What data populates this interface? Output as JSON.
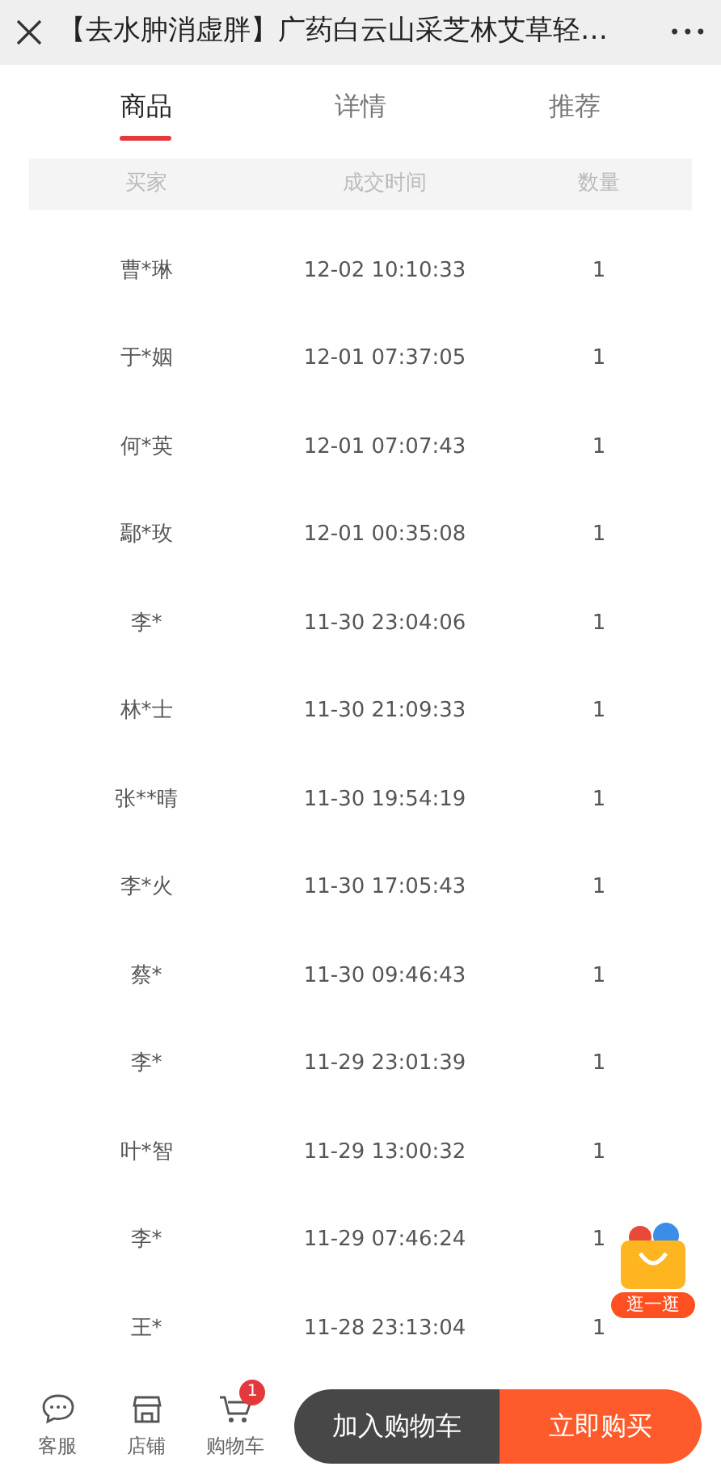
{
  "window": {
    "title": "【去水肿消虚胖】广药白云山采芝林艾草轻…",
    "more": "•••"
  },
  "tabs": [
    {
      "label": "商品",
      "selected": true
    },
    {
      "label": "详情",
      "selected": false
    },
    {
      "label": "推荐",
      "selected": false
    }
  ],
  "table": {
    "columns": [
      "买家",
      "成交时间",
      "数量"
    ],
    "rows": [
      [
        "曹*琳",
        "12-02 10:10:33",
        "1"
      ],
      [
        "于*姻",
        "12-01 07:37:05",
        "1"
      ],
      [
        "何*英",
        "12-01 07:07:43",
        "1"
      ],
      [
        "鄢*玫",
        "12-01 00:35:08",
        "1"
      ],
      [
        "李*",
        "11-30 23:04:06",
        "1"
      ],
      [
        "林*士",
        "11-30 21:09:33",
        "1"
      ],
      [
        "张**晴",
        "11-30 19:54:19",
        "1"
      ],
      [
        "李*火",
        "11-30 17:05:43",
        "1"
      ],
      [
        "蔡*",
        "11-30 09:46:43",
        "1"
      ],
      [
        "李*",
        "11-29 23:01:39",
        "1"
      ],
      [
        "叶*智",
        "11-29 13:00:32",
        "1"
      ],
      [
        "李*",
        "11-29 07:46:24",
        "1"
      ],
      [
        "王*",
        "11-28 23:13:04",
        "1"
      ]
    ]
  },
  "float_badge": {
    "label": "逛一逛"
  },
  "bottom_bar": {
    "icons": [
      {
        "kind": "chat",
        "label": "客服"
      },
      {
        "kind": "shop",
        "label": "店铺"
      },
      {
        "kind": "cart",
        "label": "购物车",
        "badge": "1"
      }
    ],
    "add_to_cart": "加入购物车",
    "buy_now": "立即购买"
  }
}
